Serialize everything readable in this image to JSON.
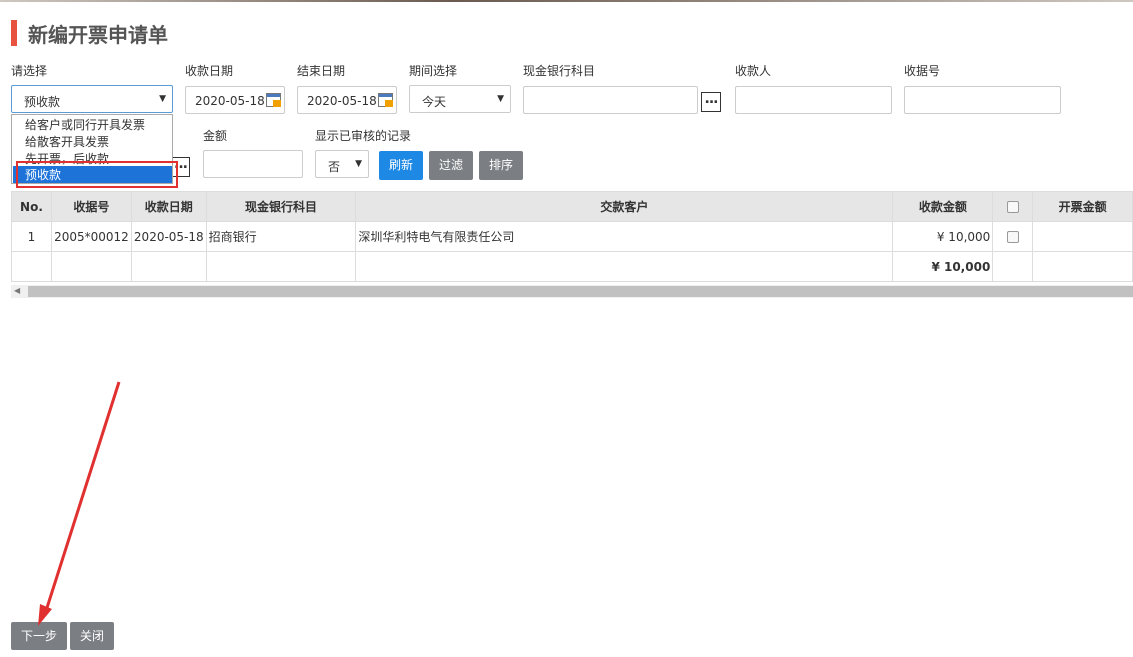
{
  "page": {
    "title": "新编开票申请单"
  },
  "filters": {
    "select_label": "请选择",
    "select_value": "预收款",
    "dropdown_options": [
      "给客户或同行开具发票",
      "给散客开具发票",
      "先开票，后收款",
      "预收款"
    ],
    "receipt_date_label": "收款日期",
    "receipt_date_value": "2020-05-18",
    "end_date_label": "结束日期",
    "end_date_value": "2020-05-18",
    "period_label": "期间选择",
    "period_value": "今天",
    "bank_account_label": "现金银行科目",
    "bank_account_value": "",
    "payee_label": "收款人",
    "payee_value": "",
    "receipt_no_label": "收据号",
    "receipt_no_value": "",
    "amount_label": "金额",
    "amount_value": "",
    "show_audited_label": "显示已审核的记录",
    "show_audited_value": "否"
  },
  "buttons": {
    "refresh": "刷新",
    "filter": "过滤",
    "sort": "排序",
    "next": "下一步",
    "close": "关闭"
  },
  "table": {
    "headers": [
      "No.",
      "收据号",
      "收款日期",
      "现金银行科目",
      "交款客户",
      "收款金额",
      "",
      "开票金额"
    ],
    "rows": [
      {
        "no": "1",
        "receipt_no": "2005*00012",
        "date": "2020-05-18",
        "bank": "招商银行",
        "customer": "深圳华利特电气有限责任公司",
        "amount": "¥ 10,000",
        "invoice_amount": ""
      }
    ],
    "total": "¥ 10,000"
  },
  "colors": {
    "accent_title": "#e8533f",
    "primary_button": "#1e88e5",
    "secondary_button": "#7b7f84",
    "selection": "#1e73d9",
    "annotation": "#e03030"
  }
}
